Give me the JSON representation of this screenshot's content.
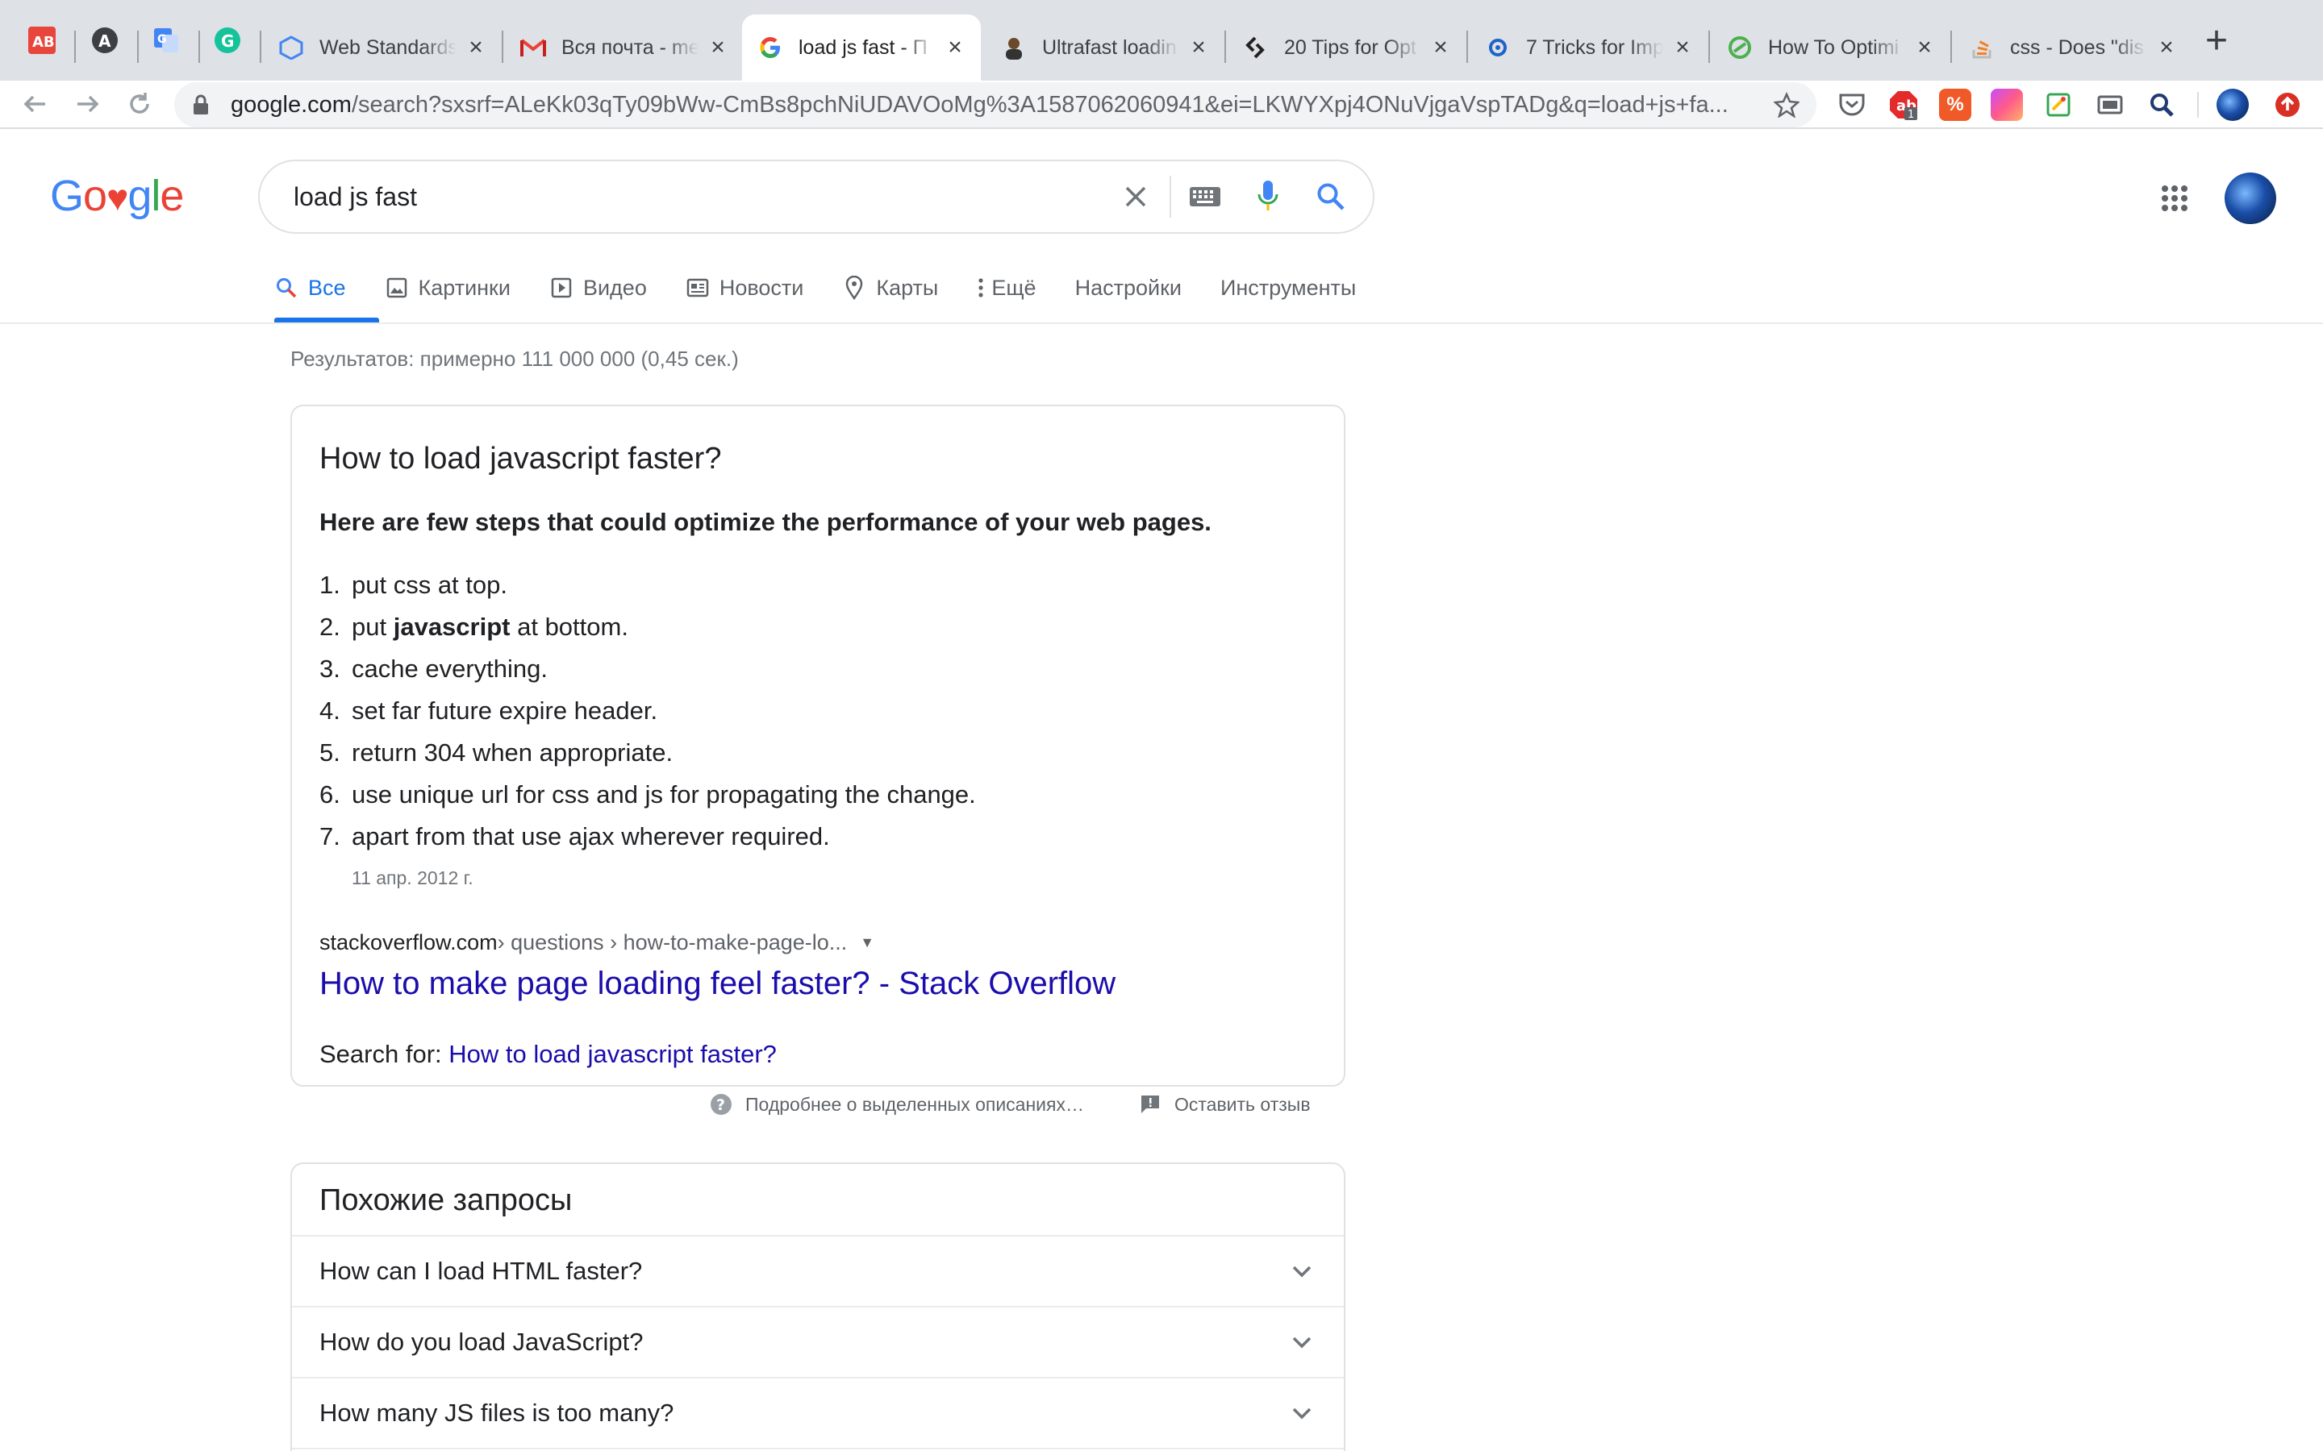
{
  "browser": {
    "tabs": [
      {
        "title": "Web Standards",
        "icon": "web-standards-icon"
      },
      {
        "title": "Вся почта - me",
        "icon": "gmail-icon"
      },
      {
        "title": "load js fast - П",
        "icon": "google-icon",
        "active": true
      },
      {
        "title": "Ultrafast loadin",
        "icon": "person-icon"
      },
      {
        "title": "20 Tips for Opt",
        "icon": "sitepoint-icon"
      },
      {
        "title": "7 Tricks for Imp",
        "icon": "gear-icon"
      },
      {
        "title": "How To Optimi",
        "icon": "green-circle-icon"
      },
      {
        "title": "css - Does \"dis",
        "icon": "stackoverflow-icon"
      }
    ],
    "url_host": "google.com",
    "url_rest": "/search?sxsrf=ALeKk03qTy09bWw-CmBs8pchNiUDAVOoMg%3A1587062060941&ei=LKWYXpj4ONuVjgaVspTADg&q=load+js+fa...",
    "extension_badge": "1"
  },
  "search": {
    "query": "load js fast"
  },
  "tabs": {
    "all": "Все",
    "images": "Картинки",
    "video": "Видео",
    "news": "Новости",
    "maps": "Карты",
    "more": "Ещё",
    "settings": "Настройки",
    "tools": "Инструменты"
  },
  "stats": "Результатов: примерно 111 000 000 (0,45 сек.)",
  "snippet": {
    "question": "How to load javascript faster?",
    "lead": "Here are few steps that could optimize the performance of your web pages.",
    "steps": [
      {
        "n": "1.",
        "before": "put css at top.",
        "bold": "",
        "after": ""
      },
      {
        "n": "2.",
        "before": "put ",
        "bold": "javascript",
        "after": " at bottom."
      },
      {
        "n": "3.",
        "before": "cache everything.",
        "bold": "",
        "after": ""
      },
      {
        "n": "4.",
        "before": "set far future expire header.",
        "bold": "",
        "after": ""
      },
      {
        "n": "5.",
        "before": "return 304 when appropriate.",
        "bold": "",
        "after": ""
      },
      {
        "n": "6.",
        "before": "use unique url for css and js for propagating the change.",
        "bold": "",
        "after": ""
      },
      {
        "n": "7.",
        "before": "apart from that use ajax wherever required.",
        "bold": "",
        "after": ""
      }
    ],
    "date": "11 апр. 2012 г.",
    "cite_domain": "stackoverflow.com",
    "cite_path": " › questions › how-to-make-page-lo...",
    "result_title": "How to make page loading feel faster? - Stack Overflow",
    "search_for_label": "Search for: ",
    "search_for_link": "How to load javascript faster?"
  },
  "feedback": {
    "about": "Подробнее о выделенных описаниях…",
    "send": "Оставить отзыв"
  },
  "related": {
    "title": "Похожие запросы",
    "items": [
      "How can I load HTML faster?",
      "How do you load JavaScript?",
      "How many JS files is too many?"
    ]
  },
  "colors": {
    "accent": "#1a73e8",
    "link": "#1a0dab",
    "logo_blue": "#4285f4",
    "logo_red": "#ea4335",
    "logo_yellow": "#fbbc05",
    "logo_green": "#34a853"
  }
}
